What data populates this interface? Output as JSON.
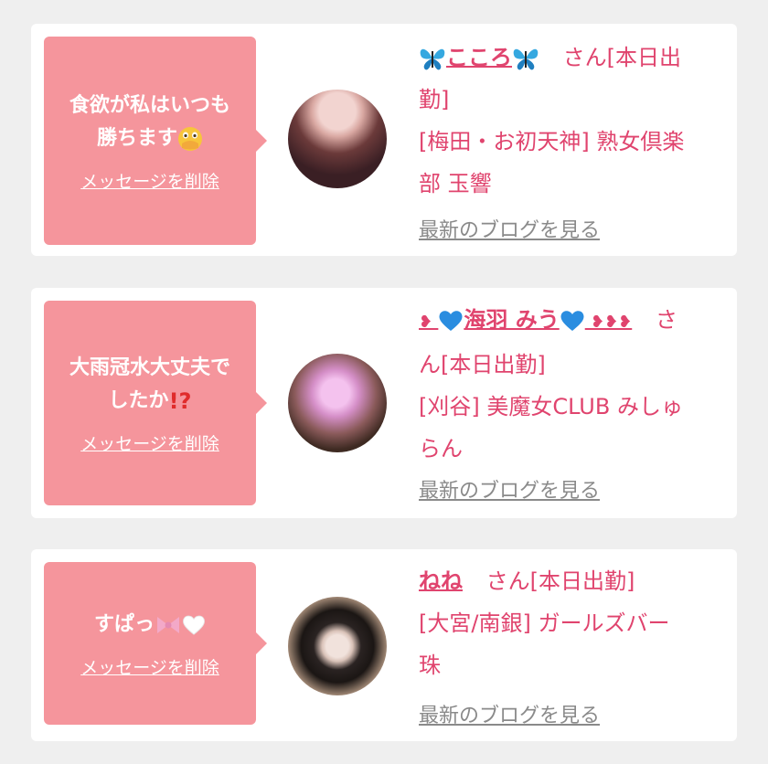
{
  "colors": {
    "bubble": "#f5959c",
    "name": "#e0446e",
    "muted": "#8a8a8a",
    "background": "#efefef"
  },
  "delete_label": "メッセージを削除",
  "blog_label": "最新のブログを見る",
  "cards": [
    {
      "message_line1": "食欲が私はいつも",
      "message_line2": "勝ちます",
      "message_emoji": "face-with-hand-over-mouth",
      "name": "こころ",
      "name_decoration": "butterfly",
      "suffix": "さん[本日出",
      "suffix2": "勤]",
      "shop_line1": "[梅田・お初天神] 熟女倶楽",
      "shop_line2": "部 玉響"
    },
    {
      "message_line1": "大雨冠水大丈夫で",
      "message_line2": "したか",
      "message_emoji": "exclamation-question-mark",
      "name": "海羽 みう",
      "name_decoration": "blue-heart",
      "suffix": "さ",
      "suffix2": "ん[本日出勤]",
      "shop_line1": "[刈谷] 美魔女CLUB みしゅ",
      "shop_line2": "らん"
    },
    {
      "message_line1": "すぱっ",
      "message_line2": "",
      "message_emoji": "ribbon-white-heart",
      "name": "ねね",
      "name_decoration": "",
      "suffix": "さん[本日出勤]",
      "suffix2": "",
      "shop_line1": "[大宮/南銀] ガールズバー",
      "shop_line2": "珠"
    }
  ]
}
